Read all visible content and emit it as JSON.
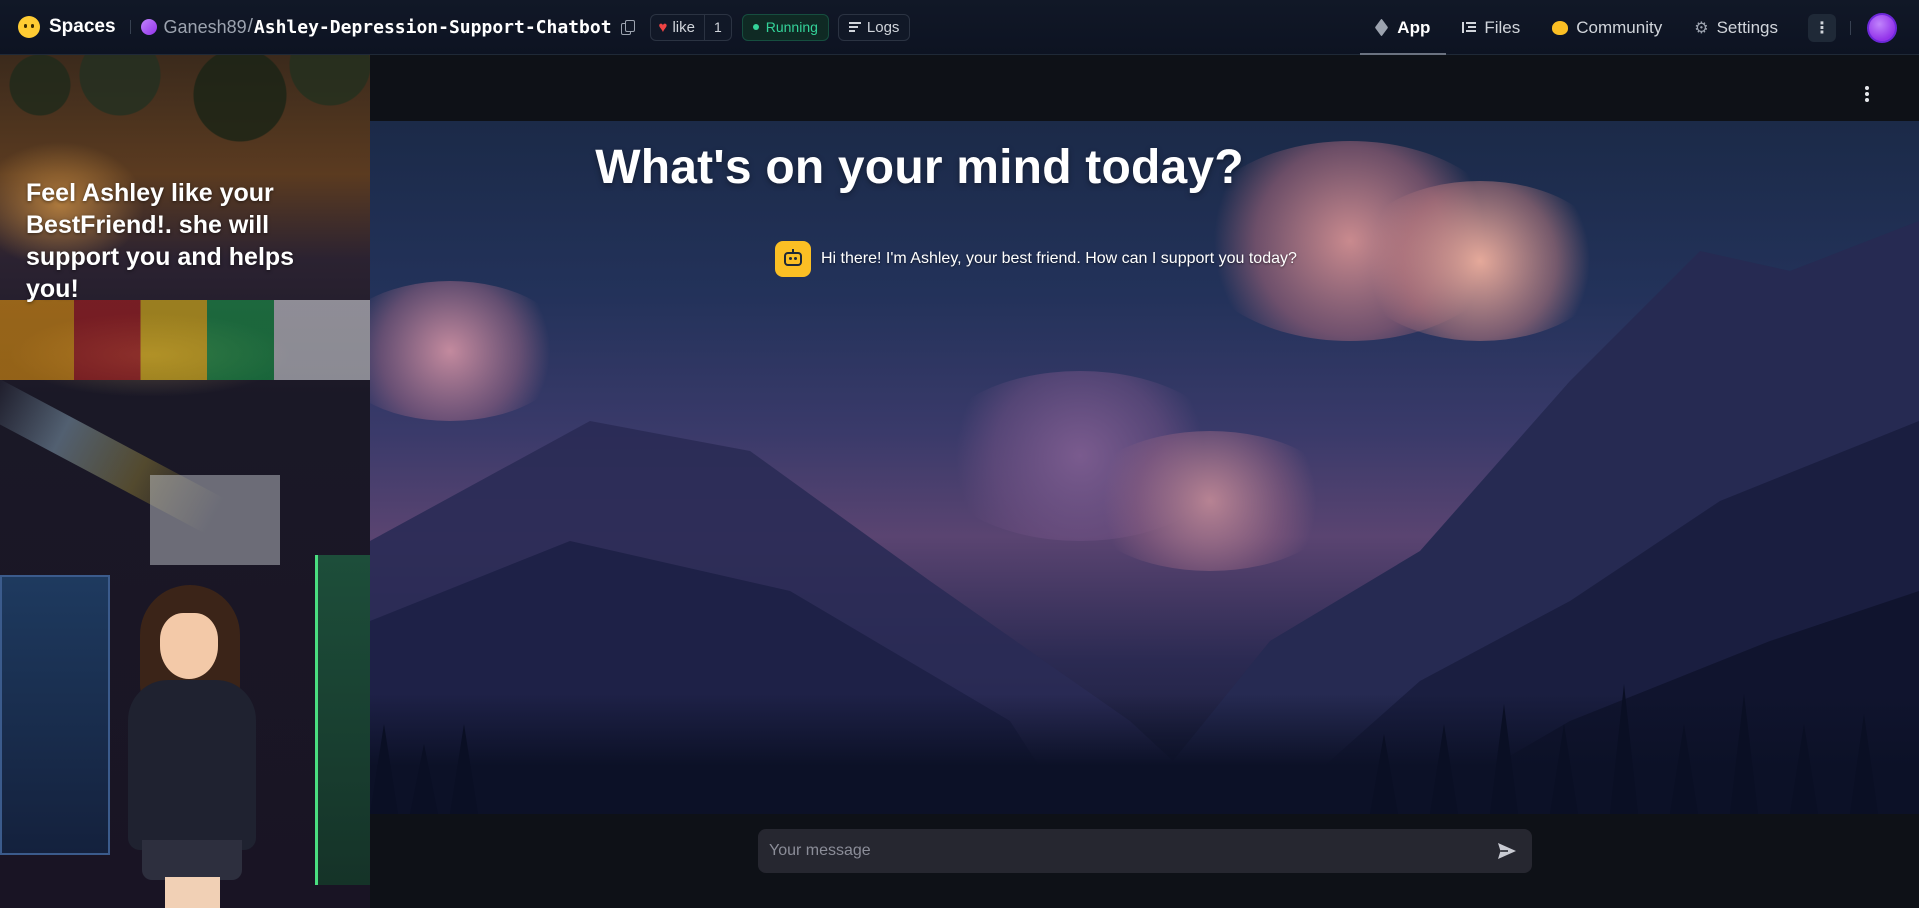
{
  "topbar": {
    "brand": "Spaces",
    "owner": "Ganesh89",
    "separator": "/",
    "repo": "Ashley-Depression-Support-Chatbot",
    "like_label": "like",
    "like_count": "1",
    "status": "Running",
    "logs_label": "Logs"
  },
  "nav": {
    "items": [
      {
        "label": "App",
        "icon": "cube-icon",
        "active": true
      },
      {
        "label": "Files",
        "icon": "files-icon",
        "active": false
      },
      {
        "label": "Community",
        "icon": "community-icon",
        "active": false
      },
      {
        "label": "Settings",
        "icon": "gear-icon",
        "active": false
      }
    ]
  },
  "sidebar": {
    "text": "Feel Ashley like your BestFriend!. she will support you and helps you!"
  },
  "main": {
    "title": "What's on your mind today?",
    "messages": [
      {
        "role": "assistant",
        "avatar": "bot-icon",
        "text": "Hi there! I'm Ashley, your best friend. How can I support you today?"
      }
    ],
    "input": {
      "value": "",
      "placeholder": "Your message"
    }
  },
  "colors": {
    "running": "#34d399",
    "heart": "#ef4444",
    "bot_avatar": "#fbbf24",
    "avatar": "#a855f7",
    "background": "#0e1117"
  }
}
